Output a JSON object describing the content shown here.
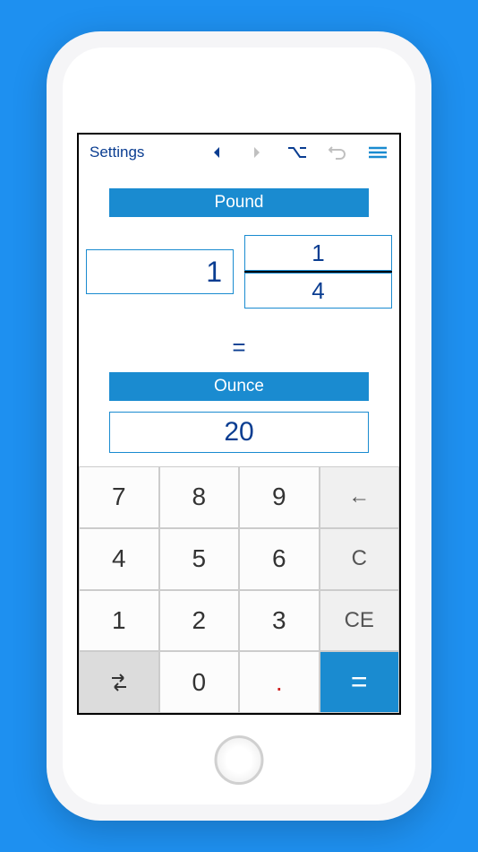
{
  "toolbar": {
    "settings_label": "Settings"
  },
  "input": {
    "unit_label": "Pound",
    "whole": "1",
    "numerator": "1",
    "denominator": "4"
  },
  "equals": "=",
  "output": {
    "unit_label": "Ounce",
    "value": "20"
  },
  "keypad": {
    "k7": "7",
    "k8": "8",
    "k9": "9",
    "back": "←",
    "k4": "4",
    "k5": "5",
    "k6": "6",
    "clear": "C",
    "k1": "1",
    "k2": "2",
    "k3": "3",
    "clear_entry": "CE",
    "k0": "0",
    "decimal": ".",
    "equals": "="
  }
}
